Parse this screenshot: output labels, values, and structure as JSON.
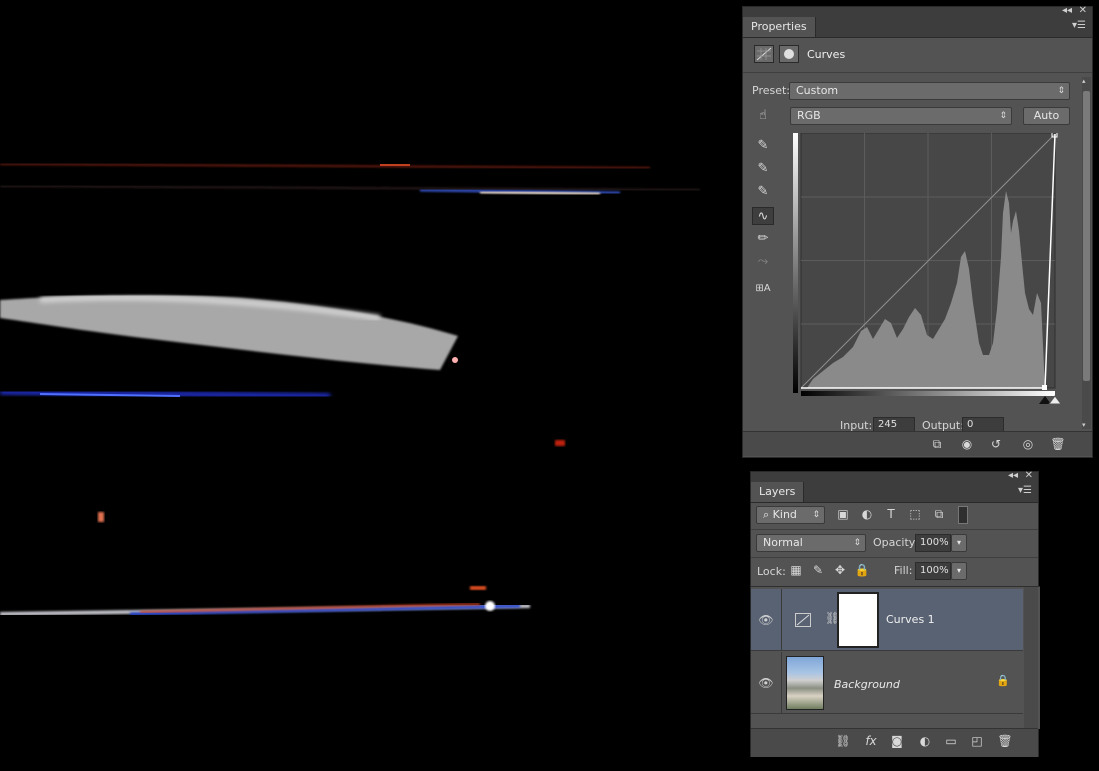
{
  "properties": {
    "tab_label": "Properties",
    "title": "Curves",
    "preset_label": "Preset:",
    "preset_value": "Custom",
    "channel_value": "RGB",
    "auto_label": "Auto",
    "input_label": "Input:",
    "input_value": "245",
    "output_label": "Output:",
    "output_value": "0"
  },
  "layers": {
    "tab_label": "Layers",
    "filter_value": "Kind",
    "blend_mode": "Normal",
    "opacity_label": "Opacity:",
    "opacity_value": "100%",
    "lock_label": "Lock:",
    "fill_label": "Fill:",
    "fill_value": "100%",
    "items": [
      {
        "name": "Curves 1",
        "selected": true
      },
      {
        "name": "Background",
        "selected": false
      }
    ]
  },
  "colors": {
    "panel_bg": "#535353",
    "panel_dark": "#3d3d3d",
    "selected_row": "#596273",
    "histogram": "#8a8a8a"
  }
}
